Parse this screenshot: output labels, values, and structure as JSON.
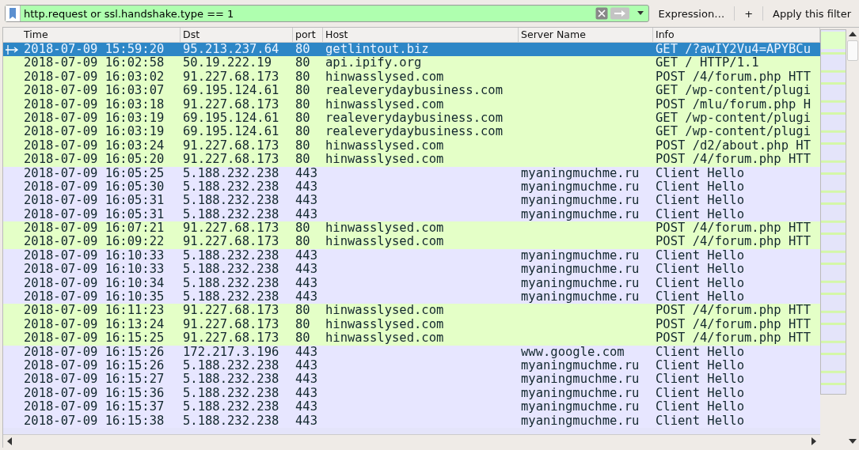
{
  "filter": {
    "value": "http.request or ssl.handshake.type == 1"
  },
  "toolbar": [
    "Expression…",
    "+",
    "Apply this filter"
  ],
  "table": {
    "columns": [
      "Time",
      "Dst",
      "port",
      "Host",
      "Server Name",
      "Info"
    ],
    "rows": [
      {
        "kind": "http",
        "selected": true,
        "cells": [
          "2018-07-09 15:59:20",
          "95.213.237.64",
          "80",
          "getlintout.biz",
          "",
          "GET /?awIY2Vu4=APYBCu"
        ]
      },
      {
        "kind": "http",
        "selected": false,
        "cells": [
          "2018-07-09 16:02:58",
          "50.19.222.19",
          "80",
          "api.ipify.org",
          "",
          "GET / HTTP/1.1"
        ]
      },
      {
        "kind": "http",
        "selected": false,
        "cells": [
          "2018-07-09 16:03:02",
          "91.227.68.173",
          "80",
          "hinwasslysed.com",
          "",
          "POST /4/forum.php HTT"
        ]
      },
      {
        "kind": "http",
        "selected": false,
        "cells": [
          "2018-07-09 16:03:07",
          "69.195.124.61",
          "80",
          "realeverydaybusiness.com",
          "",
          "GET /wp-content/plugi"
        ]
      },
      {
        "kind": "http",
        "selected": false,
        "cells": [
          "2018-07-09 16:03:18",
          "91.227.68.173",
          "80",
          "hinwasslysed.com",
          "",
          "POST /mlu/forum.php H"
        ]
      },
      {
        "kind": "http",
        "selected": false,
        "cells": [
          "2018-07-09 16:03:19",
          "69.195.124.61",
          "80",
          "realeverydaybusiness.com",
          "",
          "GET /wp-content/plugi"
        ]
      },
      {
        "kind": "http",
        "selected": false,
        "cells": [
          "2018-07-09 16:03:19",
          "69.195.124.61",
          "80",
          "realeverydaybusiness.com",
          "",
          "GET /wp-content/plugi"
        ]
      },
      {
        "kind": "http",
        "selected": false,
        "cells": [
          "2018-07-09 16:03:24",
          "91.227.68.173",
          "80",
          "hinwasslysed.com",
          "",
          "POST /d2/about.php HT"
        ]
      },
      {
        "kind": "http",
        "selected": false,
        "cells": [
          "2018-07-09 16:05:20",
          "91.227.68.173",
          "80",
          "hinwasslysed.com",
          "",
          "POST /4/forum.php HTT"
        ]
      },
      {
        "kind": "tls",
        "selected": false,
        "cells": [
          "2018-07-09 16:05:25",
          "5.188.232.238",
          "443",
          "",
          "myaningmuchme.ru",
          "Client Hello"
        ]
      },
      {
        "kind": "tls",
        "selected": false,
        "cells": [
          "2018-07-09 16:05:30",
          "5.188.232.238",
          "443",
          "",
          "myaningmuchme.ru",
          "Client Hello"
        ]
      },
      {
        "kind": "tls",
        "selected": false,
        "cells": [
          "2018-07-09 16:05:31",
          "5.188.232.238",
          "443",
          "",
          "myaningmuchme.ru",
          "Client Hello"
        ]
      },
      {
        "kind": "tls",
        "selected": false,
        "cells": [
          "2018-07-09 16:05:31",
          "5.188.232.238",
          "443",
          "",
          "myaningmuchme.ru",
          "Client Hello"
        ]
      },
      {
        "kind": "http",
        "selected": false,
        "cells": [
          "2018-07-09 16:07:21",
          "91.227.68.173",
          "80",
          "hinwasslysed.com",
          "",
          "POST /4/forum.php HTT"
        ]
      },
      {
        "kind": "http",
        "selected": false,
        "cells": [
          "2018-07-09 16:09:22",
          "91.227.68.173",
          "80",
          "hinwasslysed.com",
          "",
          "POST /4/forum.php HTT"
        ]
      },
      {
        "kind": "tls",
        "selected": false,
        "cells": [
          "2018-07-09 16:10:33",
          "5.188.232.238",
          "443",
          "",
          "myaningmuchme.ru",
          "Client Hello"
        ]
      },
      {
        "kind": "tls",
        "selected": false,
        "cells": [
          "2018-07-09 16:10:33",
          "5.188.232.238",
          "443",
          "",
          "myaningmuchme.ru",
          "Client Hello"
        ]
      },
      {
        "kind": "tls",
        "selected": false,
        "cells": [
          "2018-07-09 16:10:34",
          "5.188.232.238",
          "443",
          "",
          "myaningmuchme.ru",
          "Client Hello"
        ]
      },
      {
        "kind": "tls",
        "selected": false,
        "cells": [
          "2018-07-09 16:10:35",
          "5.188.232.238",
          "443",
          "",
          "myaningmuchme.ru",
          "Client Hello"
        ]
      },
      {
        "kind": "http",
        "selected": false,
        "cells": [
          "2018-07-09 16:11:23",
          "91.227.68.173",
          "80",
          "hinwasslysed.com",
          "",
          "POST /4/forum.php HTT"
        ]
      },
      {
        "kind": "http",
        "selected": false,
        "cells": [
          "2018-07-09 16:13:24",
          "91.227.68.173",
          "80",
          "hinwasslysed.com",
          "",
          "POST /4/forum.php HTT"
        ]
      },
      {
        "kind": "http",
        "selected": false,
        "cells": [
          "2018-07-09 16:15:25",
          "91.227.68.173",
          "80",
          "hinwasslysed.com",
          "",
          "POST /4/forum.php HTT"
        ]
      },
      {
        "kind": "tls",
        "selected": false,
        "cells": [
          "2018-07-09 16:15:26",
          "172.217.3.196",
          "443",
          "",
          "www.google.com",
          "Client Hello"
        ]
      },
      {
        "kind": "tls",
        "selected": false,
        "cells": [
          "2018-07-09 16:15:26",
          "5.188.232.238",
          "443",
          "",
          "myaningmuchme.ru",
          "Client Hello"
        ]
      },
      {
        "kind": "tls",
        "selected": false,
        "cells": [
          "2018-07-09 16:15:27",
          "5.188.232.238",
          "443",
          "",
          "myaningmuchme.ru",
          "Client Hello"
        ]
      },
      {
        "kind": "tls",
        "selected": false,
        "cells": [
          "2018-07-09 16:15:36",
          "5.188.232.238",
          "443",
          "",
          "myaningmuchme.ru",
          "Client Hello"
        ]
      },
      {
        "kind": "tls",
        "selected": false,
        "cells": [
          "2018-07-09 16:15:37",
          "5.188.232.238",
          "443",
          "",
          "myaningmuchme.ru",
          "Client Hello"
        ]
      },
      {
        "kind": "tls",
        "selected": false,
        "cells": [
          "2018-07-09 16:15:38",
          "5.188.232.238",
          "443",
          "",
          "myaningmuchme.ru",
          "Client Hello"
        ]
      }
    ]
  }
}
